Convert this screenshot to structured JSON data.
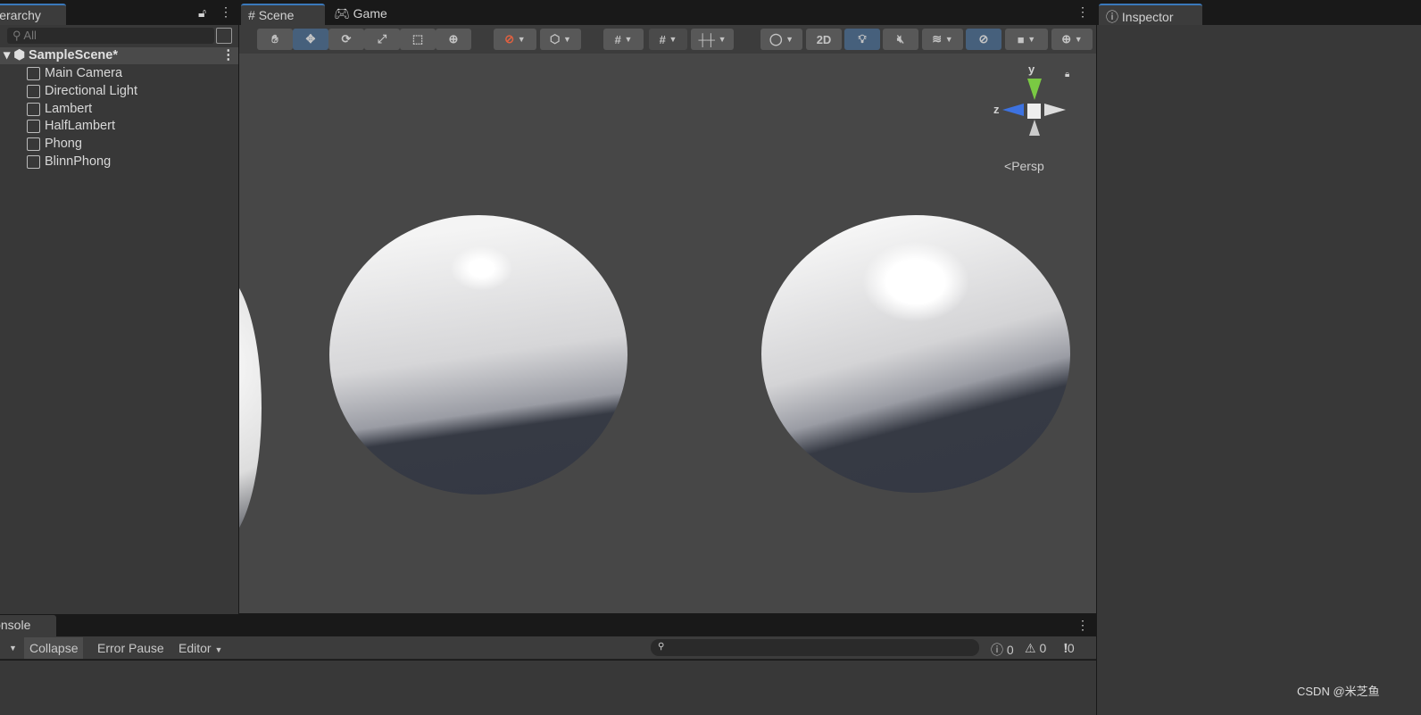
{
  "hierarchy": {
    "tab": "Hierarchy",
    "search_placeholder": "All",
    "scene": "SampleScene*",
    "items": [
      "Main Camera",
      "Directional Light",
      "Lambert",
      "HalfLambert",
      "Phong",
      "BlinnPhong"
    ]
  },
  "scene_view": {
    "tabs": [
      "Scene",
      "Game"
    ],
    "tools": [
      "hand",
      "move",
      "rotate",
      "scale",
      "rect",
      "transform"
    ],
    "btn_2d": "2D",
    "projection": "Persp",
    "gizmo_axes": {
      "y": "y",
      "z": "z"
    }
  },
  "inspector": {
    "tab": "Inspector"
  },
  "console": {
    "tab": "Console",
    "collapse": "Collapse",
    "error_pause": "Error Pause",
    "editor": "Editor",
    "counts": {
      "log": "0",
      "warn": "0",
      "error": "0"
    }
  },
  "watermark": "CSDN @米芝鱼"
}
